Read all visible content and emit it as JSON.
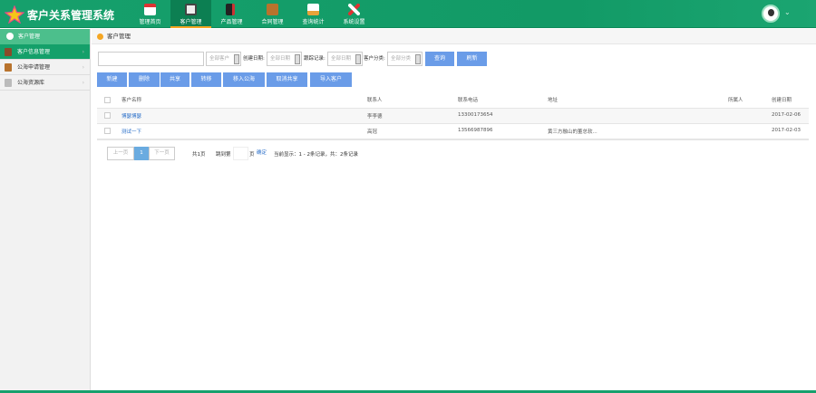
{
  "app": {
    "title": "客户关系管理系统"
  },
  "nav": [
    {
      "label": "管理首页",
      "icon": "home-icon"
    },
    {
      "label": "客户管理",
      "icon": "monitor-icon",
      "active": true
    },
    {
      "label": "产品管理",
      "icon": "book-icon"
    },
    {
      "label": "合同管理",
      "icon": "briefcase-icon"
    },
    {
      "label": "查询统计",
      "icon": "chart-icon"
    },
    {
      "label": "系统设置",
      "icon": "tools-icon"
    }
  ],
  "sidebar": {
    "header": "客户管理",
    "items": [
      {
        "label": "客户信息管理",
        "active": true
      },
      {
        "label": "公海申请管理"
      },
      {
        "label": "公海资源库"
      }
    ]
  },
  "breadcrumb": "客户管理",
  "filters": {
    "search_value": "",
    "customer_select": "全部客户",
    "created_label": "创建日期:",
    "created_select": "全部日期",
    "track_label": "跟踪记录:",
    "track_select": "全部日期",
    "category_label": "客户分类:",
    "category_select": "全部分类",
    "query": "查询",
    "refresh": "刷新"
  },
  "actions": [
    "新建",
    "删除",
    "共享",
    "转移",
    "移入公海",
    "取消共享",
    "导入客户"
  ],
  "table": {
    "headers": [
      "客户名称",
      "联系人",
      "联系电话",
      "地址",
      "所属人",
      "创建日期"
    ],
    "rows": [
      [
        "博瑟博瑟",
        "李李德",
        "13300173654",
        "",
        "",
        "2017-02-06"
      ],
      [
        "测试一下",
        "高冠",
        "13566987896",
        "黄三方融山的董总软...",
        "",
        "2017-02-03"
      ]
    ]
  },
  "pagination": {
    "prev": "上一页",
    "current": "1",
    "next": "下一页",
    "total_pages": "共1页",
    "goto_label": "跳到第",
    "page_unit": "页",
    "confirm": "确定",
    "summary": "当前显示：1 - 2条记录，共：2条记录"
  },
  "colors": {
    "header": "#16a06c",
    "active_side": "#14a06a",
    "button": "#6a9ce8",
    "accent": "#f5a623"
  }
}
